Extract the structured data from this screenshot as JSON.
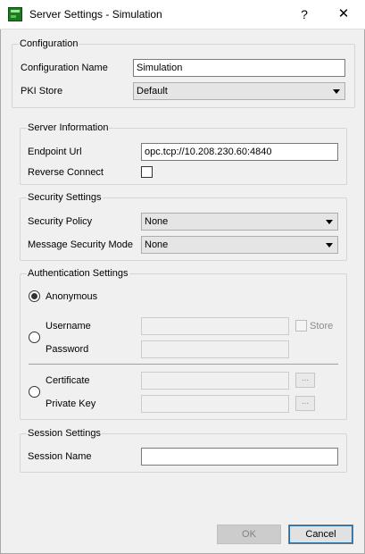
{
  "window": {
    "title": "Server Settings - Simulation",
    "help_glyph": "?",
    "close_glyph": "✕"
  },
  "configuration": {
    "group_title": "Configuration",
    "name_label": "Configuration Name",
    "name_value": "Simulation",
    "pki_label": "PKI Store",
    "pki_value": "Default"
  },
  "server_information": {
    "group_title": "Server Information",
    "endpoint_label": "Endpoint Url",
    "endpoint_value": "opc.tcp://10.208.230.60:4840",
    "reverse_label": "Reverse Connect",
    "reverse_checked": false
  },
  "security_settings": {
    "group_title": "Security Settings",
    "policy_label": "Security Policy",
    "policy_value": "None",
    "mode_label": "Message Security Mode",
    "mode_value": "None"
  },
  "authentication": {
    "group_title": "Authentication Settings",
    "anonymous_label": "Anonymous",
    "selected": "anonymous",
    "username_label": "Username",
    "store_label": "Store",
    "password_label": "Password",
    "certificate_label": "Certificate",
    "private_key_label": "Private Key",
    "browse_glyph": "..."
  },
  "session": {
    "group_title": "Session Settings",
    "name_label": "Session Name",
    "name_value": ""
  },
  "buttons": {
    "ok_label": "OK",
    "cancel_label": "Cancel"
  }
}
